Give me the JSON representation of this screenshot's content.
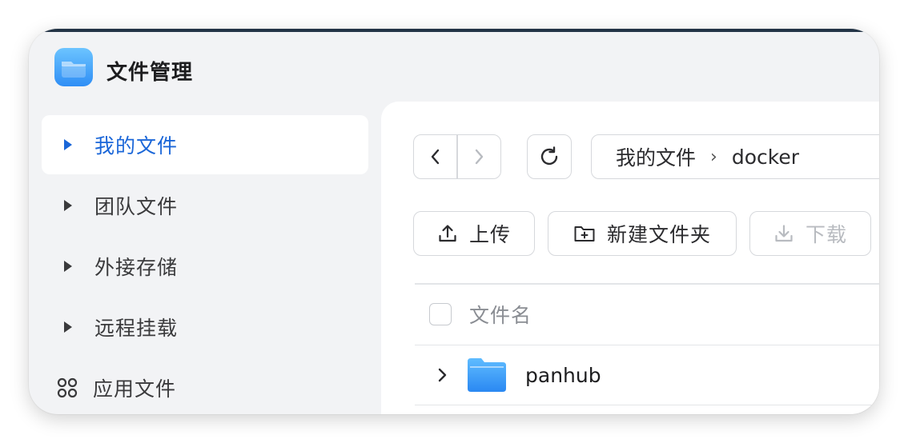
{
  "app": {
    "title": "文件管理",
    "icon": "folder-app-icon"
  },
  "sidebar": {
    "items": [
      {
        "label": "我的文件",
        "icon": "caret-right-icon",
        "active": true
      },
      {
        "label": "团队文件",
        "icon": "caret-right-icon",
        "active": false
      },
      {
        "label": "外接存储",
        "icon": "caret-right-icon",
        "active": false
      },
      {
        "label": "远程挂载",
        "icon": "caret-right-icon",
        "active": false
      },
      {
        "label": "应用文件",
        "icon": "apps-grid-icon",
        "active": false
      }
    ]
  },
  "toolbar": {
    "back_icon": "chevron-left-icon",
    "forward_icon": "chevron-right-icon",
    "refresh_icon": "refresh-icon",
    "breadcrumb": [
      "我的文件",
      "docker"
    ],
    "upload_label": "上传",
    "new_folder_label": "新建文件夹",
    "download_label": "下载"
  },
  "table": {
    "column_name": "文件名",
    "rows": [
      {
        "name": "panhub",
        "type": "folder"
      }
    ]
  },
  "colors": {
    "accent": "#1a66d8",
    "sidebar_bg": "#f2f3f5",
    "disabled_text": "#b8bbc0"
  }
}
